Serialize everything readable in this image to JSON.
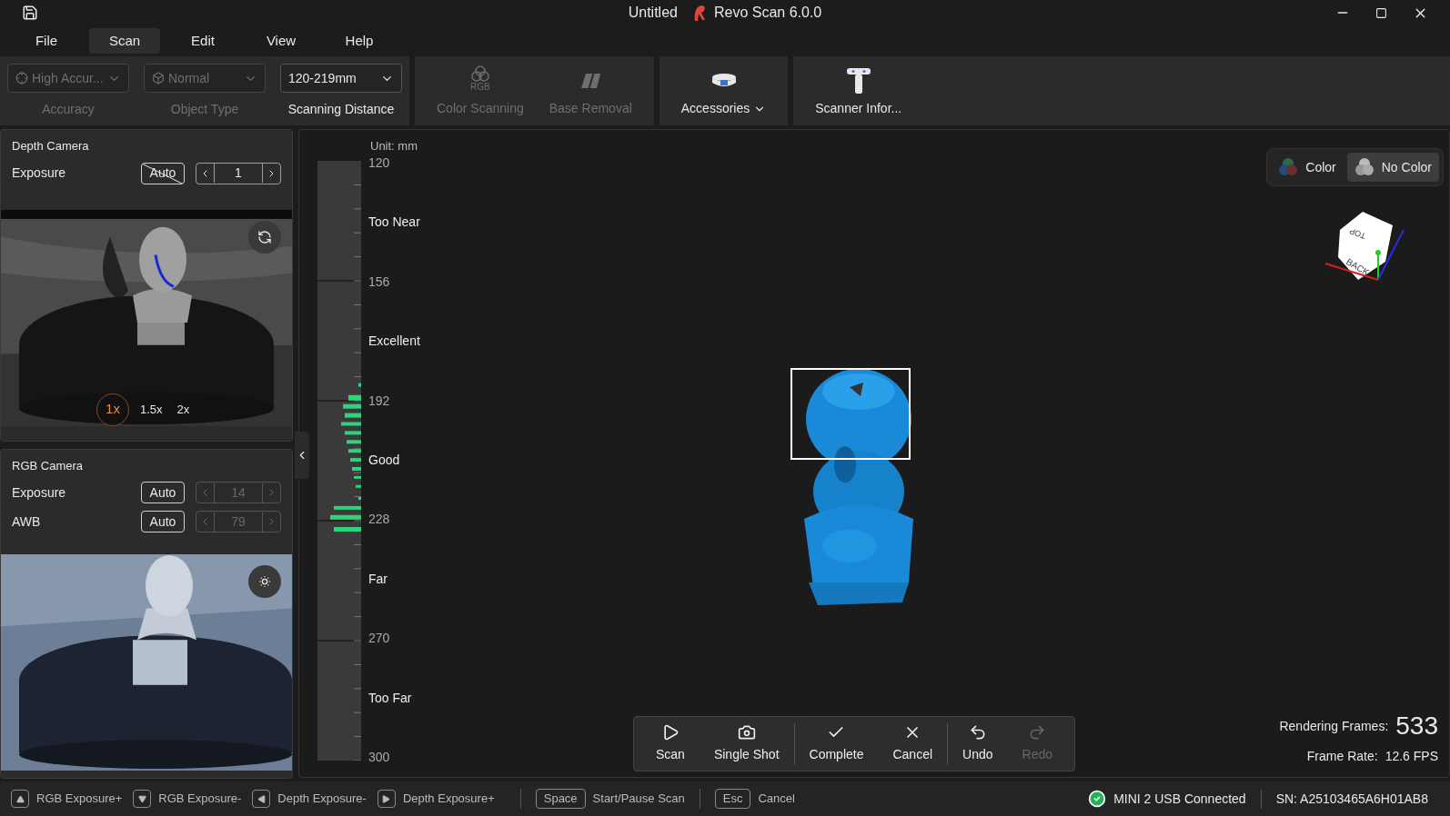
{
  "window": {
    "title": "Untitled",
    "app_name": "Revo Scan 6.0.0"
  },
  "menu": [
    {
      "label": "File",
      "selected": false
    },
    {
      "label": "Scan",
      "selected": true
    },
    {
      "label": "Edit",
      "selected": false
    },
    {
      "label": "View",
      "selected": false
    },
    {
      "label": "Help",
      "selected": false
    }
  ],
  "toolbar": {
    "dropdowns": [
      {
        "kind": "accuracy",
        "value": "High Accur...",
        "caption": "Accuracy",
        "disabled": true
      },
      {
        "kind": "object",
        "value": "Normal",
        "caption": "Object Type",
        "disabled": true
      },
      {
        "kind": "plain",
        "value": "120-219mm",
        "caption": "Scanning Distance",
        "disabled": false
      }
    ],
    "tools": [
      {
        "kind": "rgb",
        "label": "Color Scanning",
        "icon_text": "RGB",
        "disabled": true
      },
      {
        "kind": "base",
        "label": "Base Removal",
        "disabled": true
      }
    ],
    "accessories": {
      "label": "Accessories",
      "kind": "turntable"
    },
    "scanner_info": {
      "label": "Scanner Infor...",
      "kind": "scanner"
    }
  },
  "depth_camera": {
    "title": "Depth Camera",
    "controls": [
      {
        "label": "Exposure",
        "auto": false,
        "auto_label": "Auto",
        "value": "1"
      }
    ],
    "zoom_levels": [
      {
        "label": "1x",
        "selected": true
      },
      {
        "label": "1.5x",
        "selected": false
      },
      {
        "label": "2x",
        "selected": false
      }
    ]
  },
  "rgb_camera": {
    "title": "RGB Camera",
    "controls": [
      {
        "label": "Exposure",
        "auto": true,
        "auto_label": "Auto",
        "value": "14"
      },
      {
        "label": "AWB",
        "auto": true,
        "auto_label": "Auto",
        "value": "79"
      }
    ]
  },
  "gauge": {
    "unit": "Unit: mm",
    "labels": [
      {
        "text": "120",
        "kind": "value"
      },
      {
        "text": "Too Near",
        "kind": "zone"
      },
      {
        "text": "156",
        "kind": "value"
      },
      {
        "text": "Excellent",
        "kind": "zone"
      },
      {
        "text": "192",
        "kind": "value"
      },
      {
        "text": "Good",
        "kind": "zone"
      },
      {
        "text": "228",
        "kind": "value"
      },
      {
        "text": "Far",
        "kind": "zone"
      },
      {
        "text": "270",
        "kind": "value"
      },
      {
        "text": "Too Far",
        "kind": "zone"
      },
      {
        "text": "300",
        "kind": "value"
      }
    ]
  },
  "color_mode": [
    {
      "label": "Color",
      "kind": "color",
      "selected": false
    },
    {
      "label": "No Color",
      "kind": "mono",
      "selected": true
    }
  ],
  "view_cube": {
    "faces": [
      "TOP",
      "BACK"
    ]
  },
  "scan_controls": [
    [
      {
        "kind": "play",
        "label": "Scan",
        "disabled": false
      },
      {
        "kind": "camera",
        "label": "Single Shot",
        "disabled": false
      }
    ],
    [
      {
        "kind": "check",
        "label": "Complete",
        "disabled": false
      },
      {
        "kind": "close",
        "label": "Cancel",
        "disabled": false
      }
    ],
    [
      {
        "kind": "undo",
        "label": "Undo",
        "disabled": false
      },
      {
        "kind": "redo",
        "label": "Redo",
        "disabled": true
      }
    ]
  ],
  "stats": {
    "frames_label": "Rendering Frames:",
    "frames": "533",
    "rate_label": "Frame Rate:",
    "rate": "12.6 FPS"
  },
  "status_bar": {
    "shortcuts": [
      {
        "kind": "up",
        "label": "RGB Exposure+"
      },
      {
        "kind": "down",
        "label": "RGB Exposure-"
      },
      {
        "kind": "left",
        "label": "Depth Exposure-"
      },
      {
        "kind": "right",
        "label": "Depth Exposure+"
      },
      {
        "kind": "text",
        "key": "Space",
        "label": "Start/Pause Scan"
      },
      {
        "kind": "text",
        "key": "Esc",
        "label": "Cancel"
      }
    ],
    "connection": "MINI 2 USB Connected",
    "serial": "SN: A25103465A6H01AB8"
  }
}
